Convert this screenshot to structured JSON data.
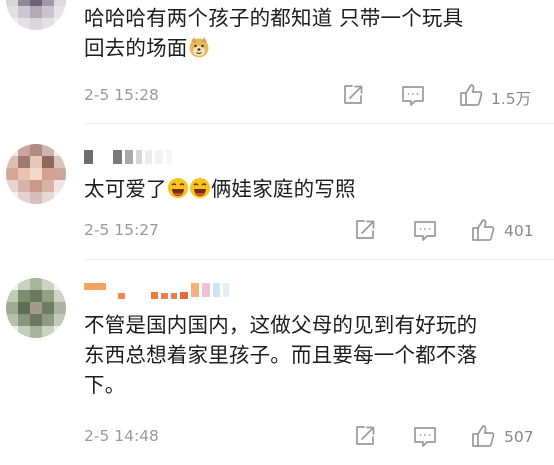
{
  "comments": [
    {
      "text_lines": [
        "哈哈哈有两个孩子的都知道 只带一个玩具",
        "回去的场面"
      ],
      "emoji": "doge",
      "time": "2-5 15:28",
      "likes": "1.5万"
    },
    {
      "text_before": "太可爱了",
      "text_after": "俩娃家庭的写照",
      "time": "2-5 15:27",
      "likes": "401"
    },
    {
      "text_lines": [
        "不管是国内国内，这做父母的见到有好玩的",
        "东西总想着家里孩子。而且要每一个都不落",
        "下。"
      ],
      "time": "2-5 14:48",
      "likes": "507"
    }
  ],
  "colors": {
    "meta_text": "#999999",
    "icon": "#9a9a9a",
    "body_text": "#1c1c1c"
  },
  "icons": [
    "share-icon",
    "reply-icon",
    "thumb-up-icon"
  ]
}
